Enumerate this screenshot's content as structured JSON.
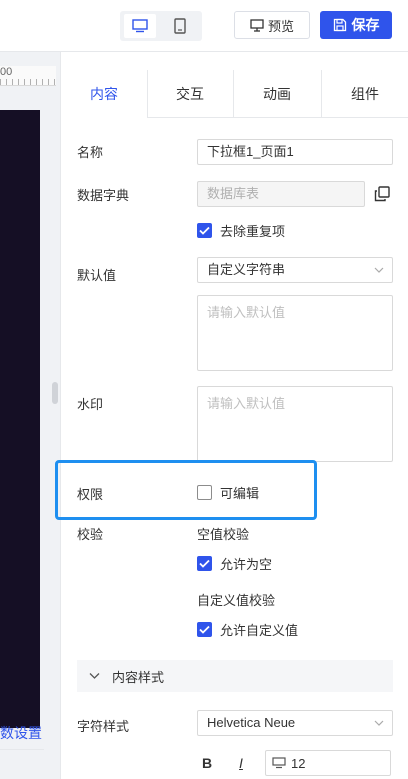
{
  "toolbar": {
    "preview_label": "预览",
    "save_label": "保存",
    "device_icons": [
      "desktop-icon",
      "tablet-icon"
    ]
  },
  "canvas": {
    "ruler_number": "00",
    "param_setting_label": "数设置"
  },
  "tabs": [
    {
      "label": "内容",
      "active": true
    },
    {
      "label": "交互",
      "active": false
    },
    {
      "label": "动画",
      "active": false
    },
    {
      "label": "组件",
      "active": false
    }
  ],
  "form": {
    "name_label": "名称",
    "name_value": "下拉框1_页面1",
    "dict_label": "数据字典",
    "dict_placeholder": "数据库表",
    "dedupe_label": "去除重复项",
    "dedupe_checked": true,
    "default_label": "默认值",
    "default_select": "自定义字符串",
    "default_placeholder": "请输入默认值",
    "watermark_label": "水印",
    "watermark_placeholder": "请输入默认值",
    "permission_label": "权限",
    "editable_label": "可编辑",
    "editable_checked": false,
    "validate_label": "校验",
    "empty_check_label": "空值校验",
    "allow_empty_label": "允许为空",
    "allow_empty_checked": true,
    "custom_check_label": "自定义值校验",
    "allow_custom_label": "允许自定义值",
    "allow_custom_checked": true
  },
  "content_style": {
    "section_label": "内容样式",
    "char_style_label": "字符样式",
    "font_value": "Helvetica Neue",
    "bold_label": "B",
    "italic_label": "I",
    "font_size_value": "12"
  },
  "colors": {
    "accent": "#2f54eb",
    "highlight": "#1e8ff0",
    "canvas_bg": "#150f25"
  }
}
